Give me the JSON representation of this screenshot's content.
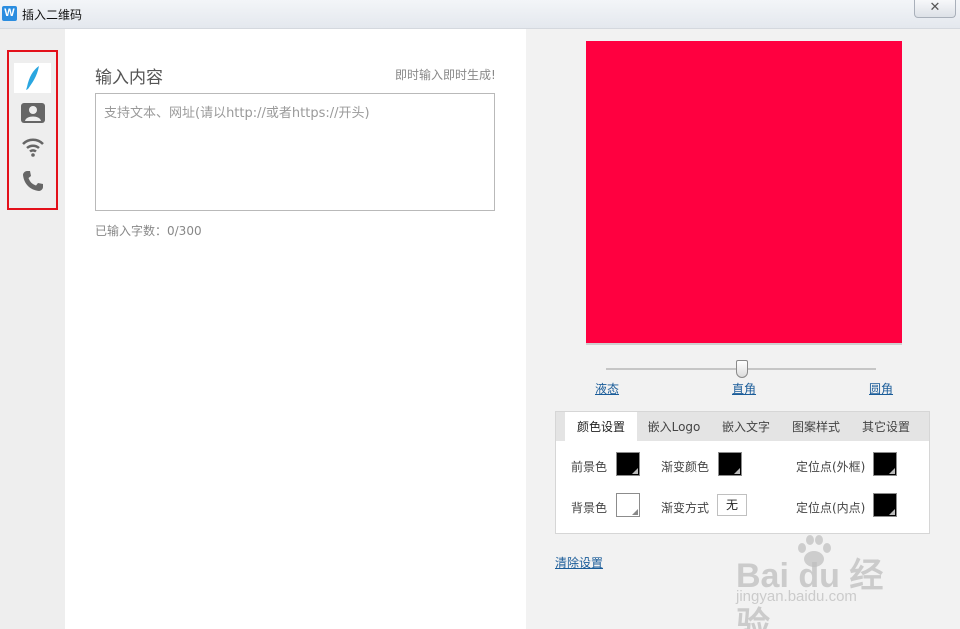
{
  "window": {
    "title": "插入二维码",
    "close_label": "✕"
  },
  "sidebar": {
    "items": [
      {
        "name": "text",
        "icon": "feather-icon",
        "active": true
      },
      {
        "name": "contact",
        "icon": "contact-card-icon",
        "active": false
      },
      {
        "name": "wifi",
        "icon": "wifi-icon",
        "active": false
      },
      {
        "name": "phone",
        "icon": "phone-icon",
        "active": false
      }
    ],
    "highlight_color": "#e3101a"
  },
  "input": {
    "label": "输入内容",
    "hint": "即时输入即时生成!",
    "placeholder": "支持文本、网址(请以http://或者https://开头)",
    "value": "",
    "char_count": "已输入字数：0/300"
  },
  "preview": {
    "color": "#ff0040"
  },
  "style_slider": {
    "labels": [
      "液态",
      "直角",
      "圆角"
    ],
    "selected": "直角"
  },
  "settings": {
    "tabs": [
      "颜色设置",
      "嵌入Logo",
      "嵌入文字",
      "图案样式",
      "其它设置"
    ],
    "active_tab": "颜色设置",
    "foreground_label": "前景色",
    "foreground_color": "#000000",
    "background_label": "背景色",
    "background_color": "#ffffff",
    "gradient_color_label": "渐变颜色",
    "gradient_color": "#000000",
    "gradient_mode_label": "渐变方式",
    "gradient_mode_value": "无",
    "anchor_outer_label": "定位点(外框)",
    "anchor_outer_color": "#000000",
    "anchor_inner_label": "定位点(内点)",
    "anchor_inner_color": "#000000"
  },
  "clear_settings": "清除设置",
  "watermark": {
    "logo_text": "Bai du 经验",
    "url": "jingyan.baidu.com"
  }
}
